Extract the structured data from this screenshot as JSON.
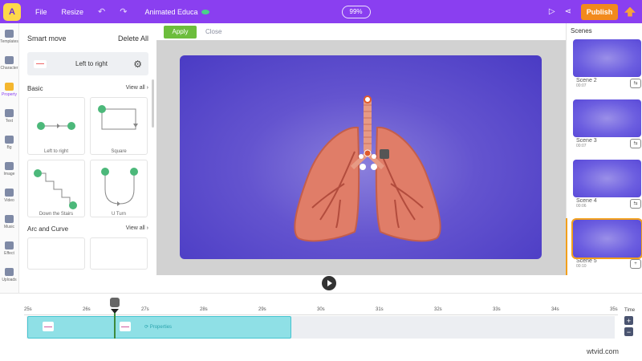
{
  "topbar": {
    "file": "File",
    "resize": "Resize",
    "title": "Animated Educa",
    "zoom": "99%",
    "publish": "Publish"
  },
  "leftnav": [
    {
      "label": "Templates",
      "icon": "templates-icon"
    },
    {
      "label": "Character",
      "icon": "character-icon"
    },
    {
      "label": "Property",
      "icon": "property-icon",
      "active": true
    },
    {
      "label": "Text",
      "icon": "text-icon"
    },
    {
      "label": "Bg",
      "icon": "bg-icon"
    },
    {
      "label": "Image",
      "icon": "image-icon"
    },
    {
      "label": "Video",
      "icon": "video-icon"
    },
    {
      "label": "Music",
      "icon": "music-icon"
    },
    {
      "label": "Effect",
      "icon": "effect-icon"
    },
    {
      "label": "Uploads",
      "icon": "uploads-icon"
    },
    {
      "label": "More",
      "icon": "more-icon"
    }
  ],
  "panel": {
    "title": "Smart move",
    "delete_all": "Delete All",
    "selected": "Left to right",
    "section_basic": "Basic",
    "view_all": "View all",
    "section_arc": "Arc and Curve",
    "cards": [
      {
        "label": "Left to right"
      },
      {
        "label": "Square"
      },
      {
        "label": "Down the Stairs"
      },
      {
        "label": "U Turn"
      }
    ]
  },
  "applybar": {
    "apply": "Apply",
    "close": "Close"
  },
  "scenes": {
    "title": "Scenes",
    "items": [
      {
        "name": "Scene 2",
        "time": "00:07"
      },
      {
        "name": "Scene 3",
        "time": "00:07"
      },
      {
        "name": "Scene 4",
        "time": "00:06"
      },
      {
        "name": "Scene 5",
        "time": "00:10"
      }
    ]
  },
  "timeline": {
    "ticks": [
      "25s",
      "26s",
      "27s",
      "28s",
      "29s",
      "30s",
      "31s",
      "32s",
      "33s",
      "34s",
      "35s"
    ],
    "clip_label": "Properties",
    "time_label": "Time"
  },
  "colors": {
    "brand": "#8a3ff0",
    "publish": "#f28a1c",
    "apply": "#6cbd3c",
    "canvas": "#5a49cc",
    "clip": "#8fe0e6"
  },
  "watermark": "wtvid.com"
}
